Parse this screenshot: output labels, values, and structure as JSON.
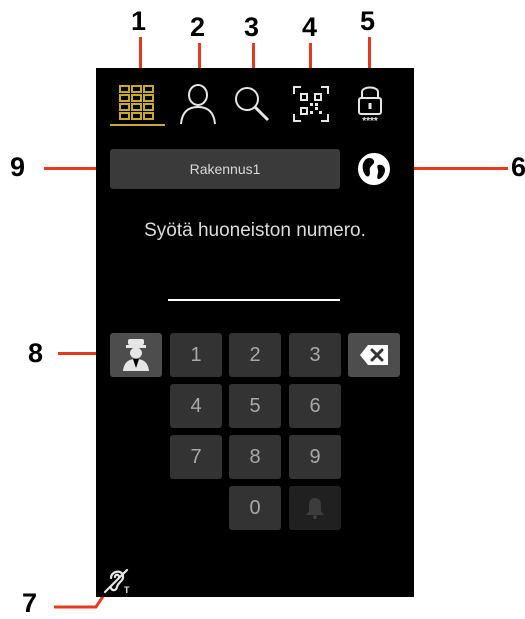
{
  "callouts": {
    "c1": "1",
    "c2": "2",
    "c3": "3",
    "c4": "4",
    "c5": "5",
    "c6": "6",
    "c7": "7",
    "c8": "8",
    "c9": "9"
  },
  "tabs": [
    {
      "icon": "apartment-grid-icon",
      "selected": true
    },
    {
      "icon": "person-icon"
    },
    {
      "icon": "search-icon"
    },
    {
      "icon": "qr-code-icon"
    },
    {
      "icon": "pin-lock-icon"
    }
  ],
  "building_selector": {
    "value": "Rakennus1"
  },
  "language_button": {
    "icon": "globe-icon"
  },
  "prompt": "Syötä huoneiston numero.",
  "keypad": {
    "k1": "1",
    "k2": "2",
    "k3": "3",
    "k4": "4",
    "k5": "5",
    "k6": "6",
    "k7": "7",
    "k8": "8",
    "k9": "9",
    "k0": "0"
  },
  "colors": {
    "accent": "#c9a92c",
    "callout_line": "#e63a1f",
    "screen_bg": "#000000",
    "key_bg": "#333333"
  }
}
